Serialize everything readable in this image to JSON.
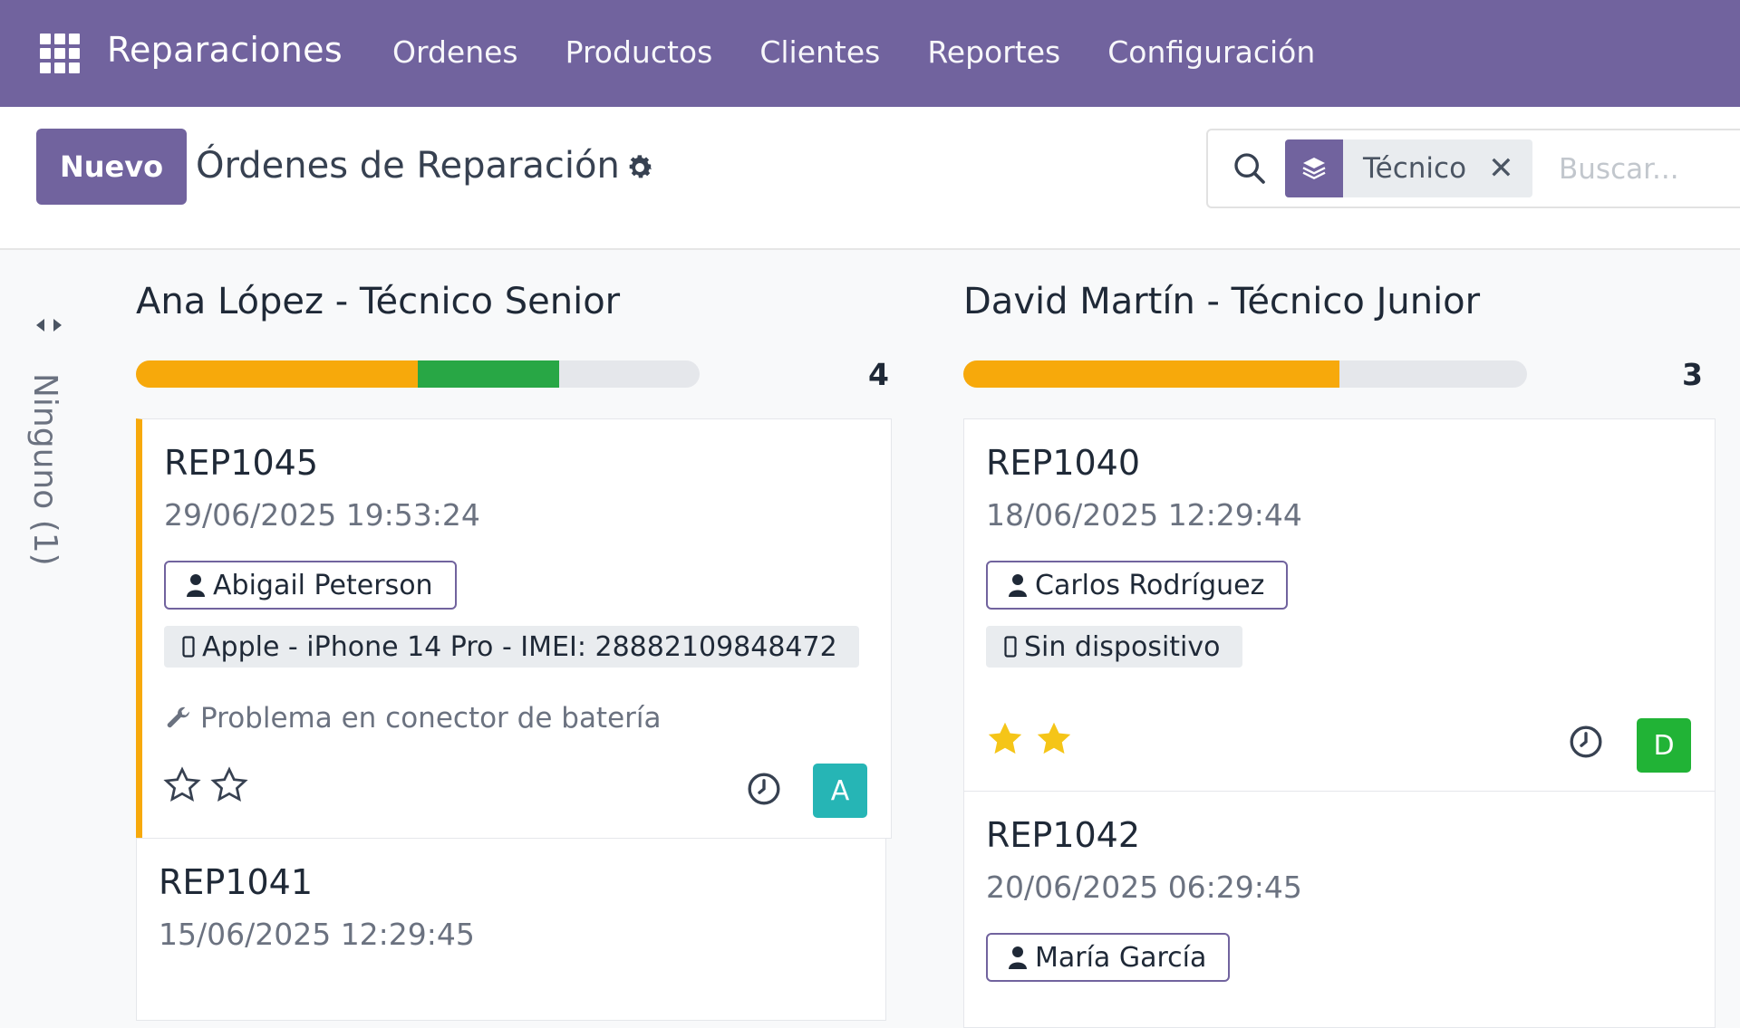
{
  "navbar": {
    "brand": "Reparaciones",
    "menu": [
      {
        "label": "Ordenes"
      },
      {
        "label": "Productos"
      },
      {
        "label": "Clientes"
      },
      {
        "label": "Reportes"
      },
      {
        "label": "Configuración"
      }
    ]
  },
  "control": {
    "new_button": "Nuevo",
    "title": "Órdenes de Reparación",
    "search": {
      "facet_label": "Técnico",
      "facet_close": "✕",
      "placeholder": "Buscar..."
    }
  },
  "folded_group": {
    "label": "Ninguno (1)"
  },
  "columns": [
    {
      "title": "Ana López - Técnico Senior",
      "count": "4",
      "progress": {
        "orange": 0.5,
        "green": 0.25
      },
      "cards": [
        {
          "ref": "REP1045",
          "date": "29/06/2025 19:53:24",
          "customer": "Abigail Peterson",
          "device": "Apple - iPhone 14 Pro - IMEI: 28882109848472",
          "problem": "Problema en conector de batería",
          "priority_stars": 0,
          "avatar": "A",
          "avatar_color": "#26b5b5",
          "accent": "#f7a90b"
        },
        {
          "ref": "REP1041",
          "date": "15/06/2025 12:29:45"
        }
      ]
    },
    {
      "title": "David Martín - Técnico Junior",
      "count": "3",
      "progress": {
        "orange": 0.667,
        "green": 0
      },
      "cards": [
        {
          "ref": "REP1040",
          "date": "18/06/2025 12:29:44",
          "customer": "Carlos Rodríguez",
          "device": "Sin dispositivo",
          "priority_stars": 2,
          "avatar": "D",
          "avatar_color": "#21b336"
        },
        {
          "ref": "REP1042",
          "date": "20/06/2025 06:29:45",
          "customer": "María García"
        }
      ]
    }
  ],
  "colors": {
    "brand": "#71639e",
    "star": "#f5c518",
    "progress_orange": "#f7a90b",
    "progress_green": "#28a745"
  }
}
